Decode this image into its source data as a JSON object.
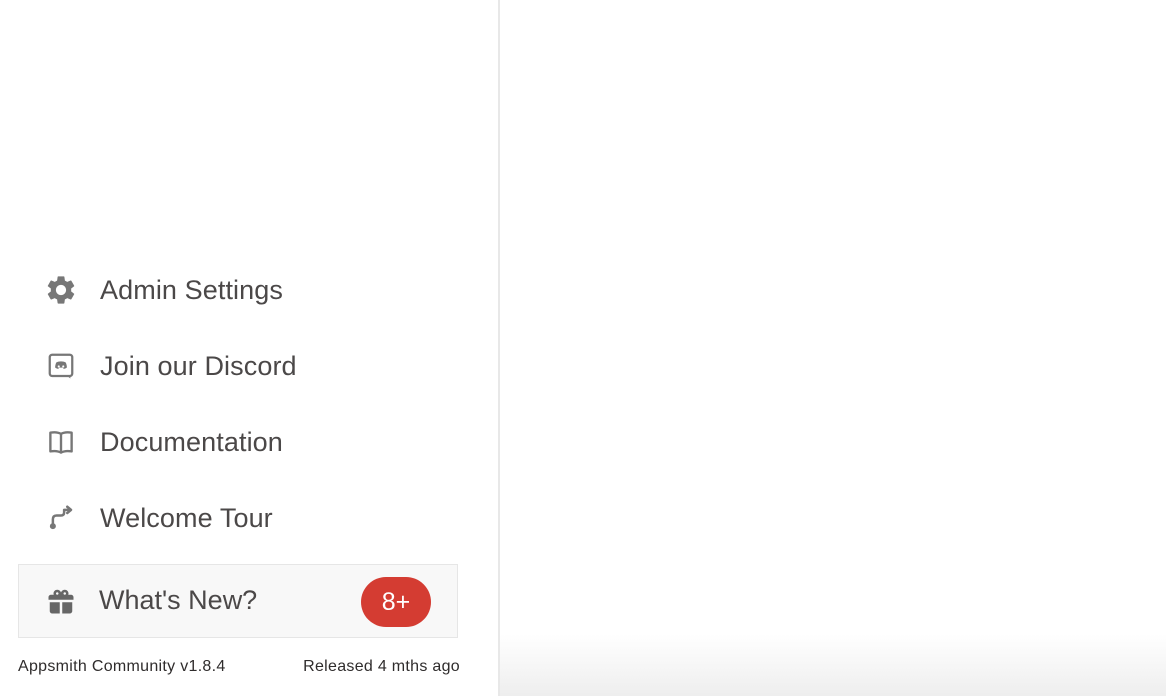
{
  "sidebar": {
    "menu": [
      {
        "label": "Admin Settings",
        "icon": "gear-icon"
      },
      {
        "label": "Join our Discord",
        "icon": "discord-icon"
      },
      {
        "label": "Documentation",
        "icon": "book-icon"
      },
      {
        "label": "Welcome Tour",
        "icon": "route-icon"
      }
    ],
    "whats_new": {
      "label": "What's New?",
      "icon": "gift-icon",
      "badge": "8+"
    },
    "footer": {
      "version": "Appsmith Community v1.8.4",
      "released": "Released 4 mths ago"
    }
  },
  "colors": {
    "text": "#4b4848",
    "icon": "#777777",
    "badge": "#d43c32",
    "divider": "#e8e8e8"
  }
}
